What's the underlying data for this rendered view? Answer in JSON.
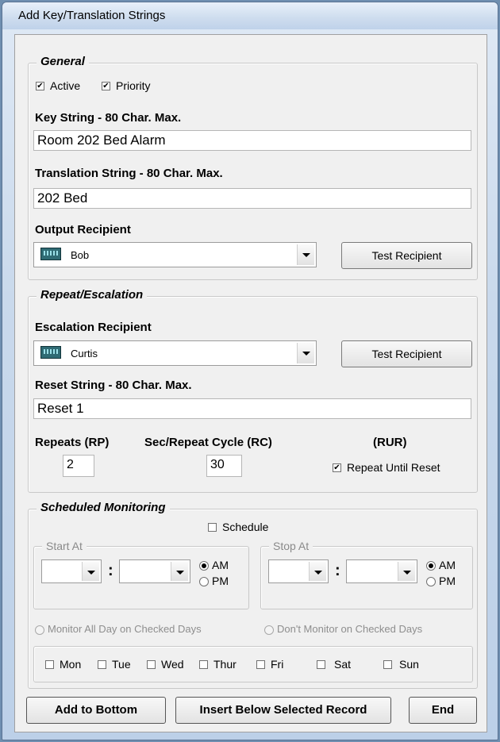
{
  "window": {
    "title": "Add Key/Translation Strings"
  },
  "general": {
    "legend": "General",
    "active_label": "Active",
    "active_checked": true,
    "priority_label": "Priority",
    "priority_checked": true,
    "key_label": "Key String - 80 Char. Max.",
    "key_value": "Room 202 Bed Alarm",
    "translation_label": "Translation String - 80 Char. Max.",
    "translation_value": "202 Bed",
    "output_label": "Output Recipient",
    "output_value": "Bob",
    "output_icon": "pager-icon",
    "test_button": "Test Recipient"
  },
  "repeat": {
    "legend": "Repeat/Escalation",
    "escalation_label": "Escalation Recipient",
    "escalation_value": "Curtis",
    "escalation_icon": "pager-icon",
    "test_button": "Test Recipient",
    "reset_label": "Reset String - 80 Char. Max.",
    "reset_value": "Reset 1",
    "repeats_label": "Repeats (RP)",
    "repeats_value": "2",
    "cycle_label": "Sec/Repeat Cycle (RC)",
    "cycle_value": "30",
    "rur_label": "(RUR)",
    "rur_checkbox_label": "Repeat Until Reset",
    "rur_checked": true
  },
  "schedule": {
    "legend": "Scheduled Monitoring",
    "schedule_label": "Schedule",
    "schedule_checked": false,
    "start_legend": "Start At",
    "stop_legend": "Stop At",
    "am_label": "AM",
    "pm_label": "PM",
    "colon": ":",
    "monitor_all_label": "Monitor All Day on Checked Days",
    "dont_monitor_label": "Don't Monitor on Checked Days",
    "days": [
      "Mon",
      "Tue",
      "Wed",
      "Thur",
      "Fri",
      "Sat",
      "Sun"
    ]
  },
  "footer": {
    "add_bottom": "Add to Bottom",
    "insert_below": "Insert Below Selected Record",
    "end": "End"
  }
}
